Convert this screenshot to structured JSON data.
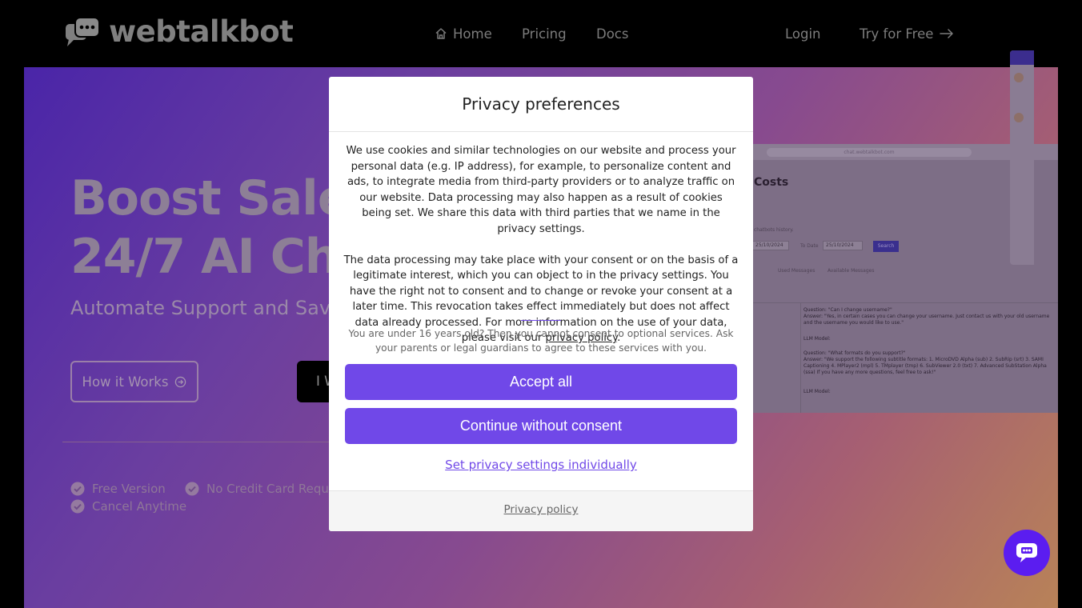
{
  "header": {
    "brand": "webtalkbot",
    "nav": {
      "home": "Home",
      "pricing": "Pricing",
      "docs": "Docs",
      "login": "Login",
      "try_free": "Try for Free"
    }
  },
  "hero": {
    "title_line1": "Boost Sales",
    "title_line2": "24/7 AI Cha",
    "subtitle": "Automate Support and Save T",
    "how_it_works": "How it Works",
    "dark_button": "I W",
    "checks": [
      "Free Version",
      "No Credit Card Requir",
      "Cancel Anytime"
    ]
  },
  "mockup": {
    "url": "chat.webtalkbot.com",
    "title": "Costs",
    "history_note": "chatbots history.",
    "from_date": "25/10/2024",
    "to_date_label": "To Date",
    "to_date": "25/10/2024",
    "search": "Search",
    "used_messages": "Used Messages",
    "available_messages": "Available Messages",
    "q1": "Question: \"Can I change username?\"",
    "a1": "Answer: \"Yes, in certain cases you can change your username. Just contact us with your old username and the username you would like to use.\"",
    "q2": "Question: \"What formats do you support?\"",
    "a2": "Answer: \"We support the following subtitle formats: 1. MicroDVD Alpha (sub) 2. SubRip (srt) 3. SAMI Captioning 4. MPlayer2 (mpl) 5. TMplayer (tmp) 6. SubViewer 2.0 (txt) 7. Advanced SubStation Alpha (ssa) If you have any more questions, feel free to ask!\"",
    "llm_label": "LLM Model:"
  },
  "consent": {
    "title": "Privacy preferences",
    "paragraph1": "We use cookies and similar technologies on our website and process your personal data (e.g. IP address), for example, to personalize content and ads, to integrate media from third-party providers or to analyze traffic on our website. Data processing may also happen as a result of cookies being set. We share this data with third parties that we name in the privacy settings.",
    "paragraph2_text": "The data processing may take place with your consent or on the basis of a legitimate interest, which you can object to in the privacy settings. You have the right not to consent and to change or revoke your consent at a later time. This revocation takes effect immediately but does not affect data already processed. For more information on the use of your data, please visit our",
    "privacy_policy_link": "privacy policy",
    "age_notice": "You are under 16 years old? Then you cannot consent to optional services. Ask your parents or legal guardians to agree to these services with you.",
    "accept_all": "Accept all",
    "continue_without": "Continue without consent",
    "set_individually": "Set privacy settings individually",
    "footer_privacy_policy": "Privacy policy"
  },
  "colors": {
    "accent": "#7048e8",
    "chat_button": "#5b1df0",
    "header_bg": "#000000"
  },
  "icons": [
    "logo-chat-icon",
    "home-icon",
    "arrow-right-icon",
    "circle-arrow-icon",
    "check-circle-icon",
    "chat-launcher-icon"
  ]
}
